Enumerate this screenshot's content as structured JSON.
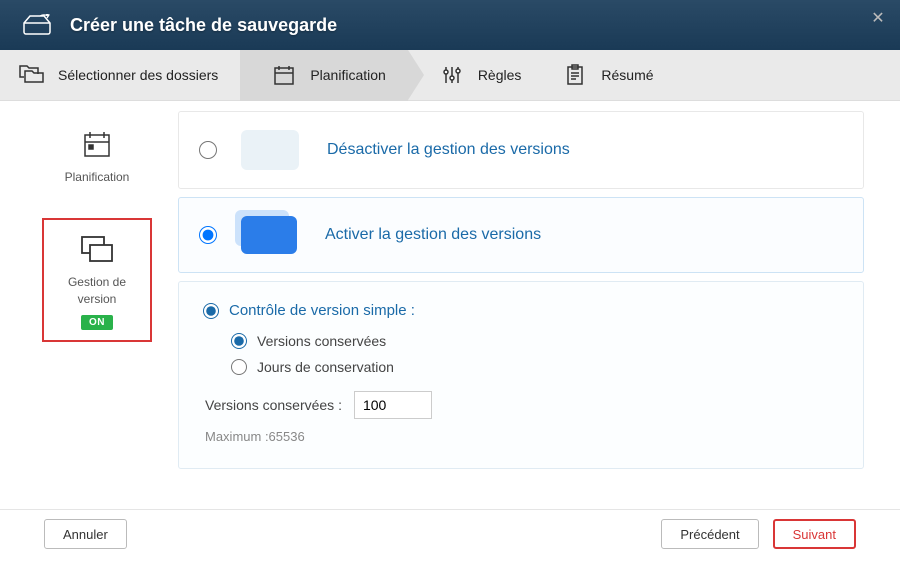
{
  "header": {
    "title": "Créer une tâche de sauvegarde"
  },
  "tabs": [
    {
      "label": "Sélectionner des dossiers"
    },
    {
      "label": "Planification"
    },
    {
      "label": "Règles"
    },
    {
      "label": "Résumé"
    }
  ],
  "sidebar": {
    "items": [
      {
        "label": "Planification"
      },
      {
        "label": "Gestion de version",
        "badge": "ON"
      }
    ]
  },
  "options": {
    "disable_label": "Désactiver la gestion des versions",
    "enable_label": "Activer la gestion des versions"
  },
  "detail": {
    "mode_simple": "Contrôle de version simple :",
    "keep_versions_label": "Versions conservées",
    "keep_days_label": "Jours de conservation",
    "versions_field_label": "Versions conservées :",
    "versions_value": "100",
    "max_hint": "Maximum :65536"
  },
  "footer": {
    "cancel": "Annuler",
    "prev": "Précédent",
    "next": "Suivant"
  }
}
